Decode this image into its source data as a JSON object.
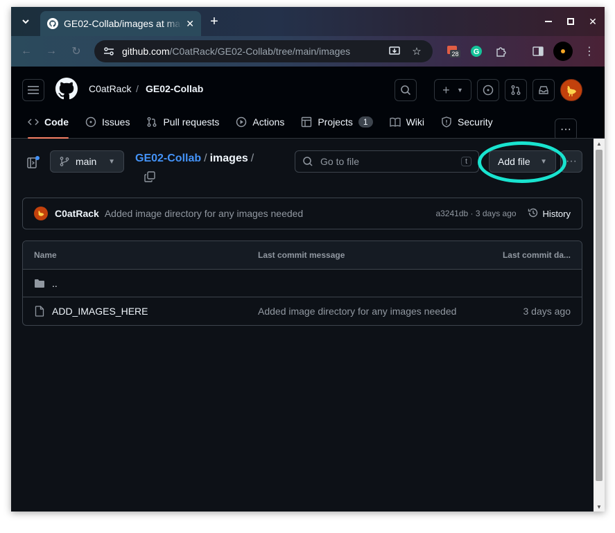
{
  "browser": {
    "tab_title": "GE02-Collab/images at main",
    "url_host": "github.com",
    "url_path": "/C0atRack/GE02-Collab/tree/main/images",
    "calendar_badge": "28"
  },
  "header": {
    "owner": "C0atRack",
    "separator": "/",
    "repo": "GE02-Collab"
  },
  "reponav": {
    "items": [
      {
        "label": "Code",
        "icon": "code-icon",
        "selected": true
      },
      {
        "label": "Issues",
        "icon": "issue-icon"
      },
      {
        "label": "Pull requests",
        "icon": "pull-request-icon"
      },
      {
        "label": "Actions",
        "icon": "play-icon"
      },
      {
        "label": "Projects",
        "icon": "table-icon",
        "count": "1"
      },
      {
        "label": "Wiki",
        "icon": "book-icon"
      },
      {
        "label": "Security",
        "icon": "shield-icon"
      }
    ]
  },
  "toolbar": {
    "branch": "main",
    "path_repo": "GE02-Collab",
    "path_dir": "images",
    "path_sep": "/",
    "goto_placeholder": "Go to file",
    "goto_shortcut": "t",
    "add_file": "Add file"
  },
  "commit": {
    "author": "C0atRack",
    "message": "Added image directory for any images needed",
    "meta": "a3241db · 3 days ago",
    "history": "History"
  },
  "table": {
    "headers": {
      "name": "Name",
      "message": "Last commit message",
      "date": "Last commit da..."
    },
    "rows": [
      {
        "name": "..",
        "message": "",
        "date": "",
        "type": "folder-icon"
      },
      {
        "name": "ADD_IMAGES_HERE",
        "message": "Added image directory for any images needed",
        "date": "3 days ago",
        "type": "file-icon"
      }
    ]
  },
  "colors": {
    "accent_link": "#4493f8",
    "underline": "#f78166",
    "highlight_ring": "#19e3cf",
    "bg": "#0d1117"
  }
}
